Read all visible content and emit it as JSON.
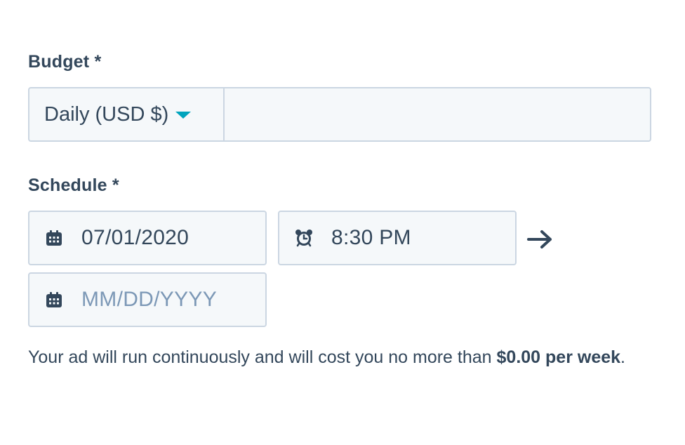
{
  "budget": {
    "label": "Budget *",
    "frequency_selected": "Daily (USD $)",
    "amount_value": ""
  },
  "schedule": {
    "label": "Schedule *",
    "start_date_value": "07/01/2020",
    "start_time_value": "8:30 PM",
    "end_date_value": "",
    "end_date_placeholder": "MM/DD/YYYY"
  },
  "summary": {
    "text_before": "Your ad will run continuously and will cost you no more than ",
    "amount_bold": "$0.00 per week",
    "text_after": "."
  },
  "icons": {
    "caret": "caret-down-icon",
    "calendar": "calendar-icon",
    "clock": "alarm-clock-icon",
    "arrow": "arrow-right-icon"
  },
  "colors": {
    "text": "#33475b",
    "accent": "#00a4bd",
    "border": "#cbd6e2",
    "field_bg": "#f5f8fa",
    "placeholder": "#7c98b6"
  }
}
